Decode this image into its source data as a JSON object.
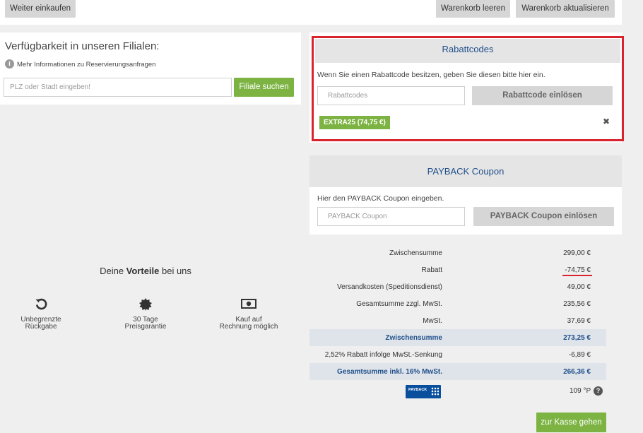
{
  "topbar": {
    "continue_label": "Weiter einkaufen",
    "clear_label": "Warenkorb leeren",
    "update_label": "Warenkorb aktualisieren"
  },
  "stores": {
    "title": "Verfügbarkeit in unseren Filialen:",
    "info_text": "Mehr Informationen zu Reservierungsanfragen",
    "search_placeholder": "PLZ oder Stadt eingeben!",
    "search_button": "Filiale suchen"
  },
  "coupon": {
    "title": "Rabattcodes",
    "hint": "Wenn Sie einen Rabattcode besitzen, geben Sie diesen bitte hier ein.",
    "input_placeholder": "Rabattcodes",
    "redeem_label": "Rabattcode einlösen",
    "applied_code": "EXTRA25 (74,75 €)",
    "remove_symbol": "✖"
  },
  "payback": {
    "title": "PAYBACK Coupon",
    "hint": "Hier den PAYBACK Coupon eingeben.",
    "input_placeholder": "PAYBACK Coupon",
    "redeem_label": "PAYBACK Coupon einlösen",
    "logo_text": "PAYBACK",
    "points": "109 °P",
    "help_symbol": "?"
  },
  "benefits": {
    "title_prefix": "Deine ",
    "title_bold": "Vorteile",
    "title_suffix": " bei uns",
    "items": [
      {
        "icon": "undo-icon",
        "line1": "Unbegrenzte",
        "line2": "Rückgabe"
      },
      {
        "icon": "seal-icon",
        "line1": "30 Tage",
        "line2": "Preisgarantie"
      },
      {
        "icon": "banknote-icon",
        "line1": "Kauf auf",
        "line2": "Rechnung möglich"
      }
    ]
  },
  "summary": {
    "rows": [
      {
        "label": "Zwischensumme",
        "value": "299,00 €"
      },
      {
        "label": "Rabatt",
        "value": "-74,75 €"
      },
      {
        "label": "Versandkosten (Speditionsdienst)",
        "value": "49,00 €"
      },
      {
        "label": "Gesamtsumme zzgl. MwSt.",
        "value": "235,56 €"
      },
      {
        "label": "MwSt.",
        "value": "37,69 €"
      },
      {
        "label": "Zwischensumme",
        "value": "273,25 €"
      },
      {
        "label": "2,52% Rabatt infolge MwSt.-Senkung",
        "value": "-6,89 €"
      },
      {
        "label": "Gesamtsumme inkl. 16% MwSt.",
        "value": "266,36 €"
      }
    ]
  },
  "checkout_label": "zur Kasse gehen",
  "colors": {
    "accent_green": "#7cb342",
    "highlight_red": "#d9232d",
    "summary_blue": "#1f4f8a",
    "payback_blue": "#0a4f9e"
  }
}
